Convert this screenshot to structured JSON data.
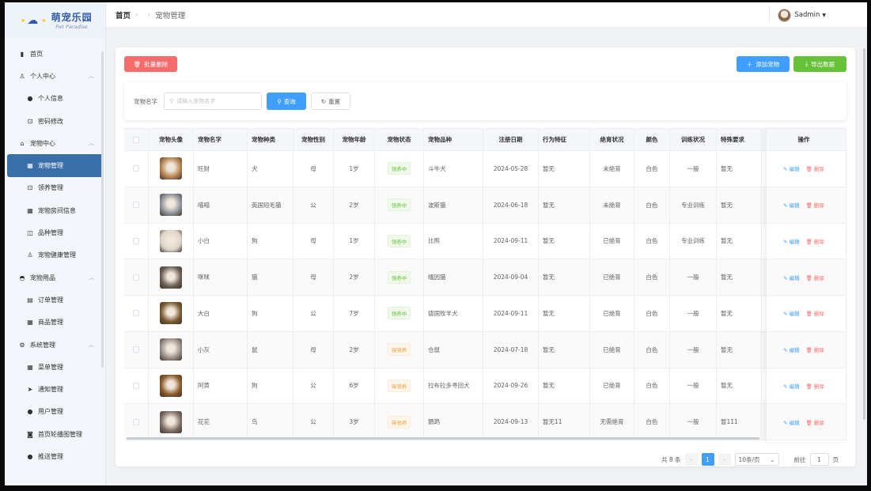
{
  "logo": {
    "title": "萌宠乐园",
    "subtitle": "Pet Paradise"
  },
  "sidebar": {
    "items": [
      {
        "label": "首页",
        "icon": "bar-chart-icon",
        "type": "top"
      },
      {
        "label": "个人中心",
        "icon": "user-icon",
        "type": "group"
      },
      {
        "label": "个人信息",
        "icon": "info-icon",
        "type": "sub"
      },
      {
        "label": "密码修改",
        "icon": "lock-icon",
        "type": "sub"
      },
      {
        "label": "宠物中心",
        "icon": "home-icon",
        "type": "group"
      },
      {
        "label": "宠物管理",
        "icon": "grid-icon",
        "type": "sub",
        "active": true
      },
      {
        "label": "领养管理",
        "icon": "lock-icon",
        "type": "sub"
      },
      {
        "label": "宠物房间信息",
        "icon": "grid-icon",
        "type": "sub"
      },
      {
        "label": "品种管理",
        "icon": "box-icon",
        "type": "sub"
      },
      {
        "label": "宠物健康管理",
        "icon": "user-icon",
        "type": "sub"
      },
      {
        "label": "宠物用品",
        "icon": "bag-icon",
        "type": "group"
      },
      {
        "label": "订单管理",
        "icon": "clipboard-icon",
        "type": "sub"
      },
      {
        "label": "商品管理",
        "icon": "grid-icon",
        "type": "sub"
      },
      {
        "label": "系统管理",
        "icon": "gear-icon",
        "type": "group"
      },
      {
        "label": "菜单管理",
        "icon": "grid-icon",
        "type": "sub"
      },
      {
        "label": "通知管理",
        "icon": "send-icon",
        "type": "sub"
      },
      {
        "label": "用户管理",
        "icon": "person-icon",
        "type": "sub"
      },
      {
        "label": "首页轮播图管理",
        "icon": "camera-icon",
        "type": "sub"
      },
      {
        "label": "推送管理",
        "icon": "info-icon",
        "type": "sub"
      }
    ]
  },
  "header": {
    "breadcrumb_home": "首页",
    "breadcrumb_current": "宠物管理",
    "user_name": "Sadmin"
  },
  "toolbar": {
    "batch_delete": "批量删除",
    "add_pet": "添加宠物",
    "export": "导出数据"
  },
  "search": {
    "label": "宠物名字",
    "placeholder": "请输入宠物名字",
    "query": "查询",
    "reset": "重置"
  },
  "table": {
    "headers": [
      "宠物头像",
      "宠物名字",
      "宠物种类",
      "宠物性别",
      "宠物年龄",
      "宠物状态",
      "宠物品种",
      "注册日期",
      "行为特征",
      "绝育状况",
      "颜色",
      "训练状况",
      "特殊要求",
      "操作"
    ],
    "edit_label": "编辑",
    "delete_label": "删除",
    "rows": [
      {
        "name": "旺财",
        "kind": "犬",
        "sex": "母",
        "age": "1岁",
        "status": "领养中",
        "breed": "斗牛犬",
        "date": "2024-05-28",
        "behavior": "暂无",
        "neuter": "未绝育",
        "color": "白色",
        "training": "一般",
        "special": "暂无",
        "photo": "#b5824f"
      },
      {
        "name": "喵喵",
        "kind": "英国短毛猫",
        "sex": "公",
        "age": "2岁",
        "status": "领养中",
        "breed": "波斯猫",
        "date": "2024-06-18",
        "behavior": "暂无",
        "neuter": "未绝育",
        "color": "白色",
        "training": "专业训练",
        "special": "暂无",
        "photo": "#8d9299"
      },
      {
        "name": "小白",
        "kind": "狗",
        "sex": "母",
        "age": "1岁",
        "status": "领养中",
        "breed": "比熊",
        "date": "2024-09-11",
        "behavior": "暂无",
        "neuter": "已绝育",
        "color": "白色",
        "training": "专业训练",
        "special": "暂无",
        "photo": "#ddd6c8"
      },
      {
        "name": "咪咪",
        "kind": "猫",
        "sex": "母",
        "age": "2岁",
        "status": "领养中",
        "breed": "缅因猫",
        "date": "2024-09-04",
        "behavior": "暂无",
        "neuter": "已绝育",
        "color": "白色",
        "training": "一般",
        "special": "暂无",
        "photo": "#6c6055"
      },
      {
        "name": "大白",
        "kind": "狗",
        "sex": "公",
        "age": "7岁",
        "status": "领养中",
        "breed": "德国牧羊犬",
        "date": "2024-09-11",
        "behavior": "暂无",
        "neuter": "已绝育",
        "color": "白色",
        "training": "一般",
        "special": "暂无",
        "photo": "#7a5a32"
      },
      {
        "name": "小灰",
        "kind": "鼠",
        "sex": "母",
        "age": "2岁",
        "status": "待领养",
        "breed": "仓鼠",
        "date": "2024-07-18",
        "behavior": "暂无",
        "neuter": "已绝育",
        "color": "白色",
        "training": "一般",
        "special": "暂无",
        "photo": "#9a8f86"
      },
      {
        "name": "阿黄",
        "kind": "狗",
        "sex": "公",
        "age": "6岁",
        "status": "待领养",
        "breed": "拉布拉多寻回犬",
        "date": "2024-09-26",
        "behavior": "暂无",
        "neuter": "已绝育",
        "color": "白色",
        "training": "一般",
        "special": "暂无",
        "photo": "#8a5a2a"
      },
      {
        "name": "花花",
        "kind": "鸟",
        "sex": "公",
        "age": "3岁",
        "status": "待领养",
        "breed": "鹦鹉",
        "date": "2024-09-13",
        "behavior": "暂无11",
        "neuter": "无需绝育",
        "color": "白色",
        "training": "一般",
        "special": "暂111",
        "photo": "#7e6f66"
      }
    ]
  },
  "pager": {
    "total": "共 8 条",
    "page": "1",
    "page_size": "10条/页",
    "goto": "前往",
    "goto_value": "1",
    "page_unit": "页"
  },
  "colors": {
    "primary": "#409eff",
    "danger": "#f56c6c",
    "success": "#67c23a",
    "sidebar_active": "#3a6ea8"
  }
}
